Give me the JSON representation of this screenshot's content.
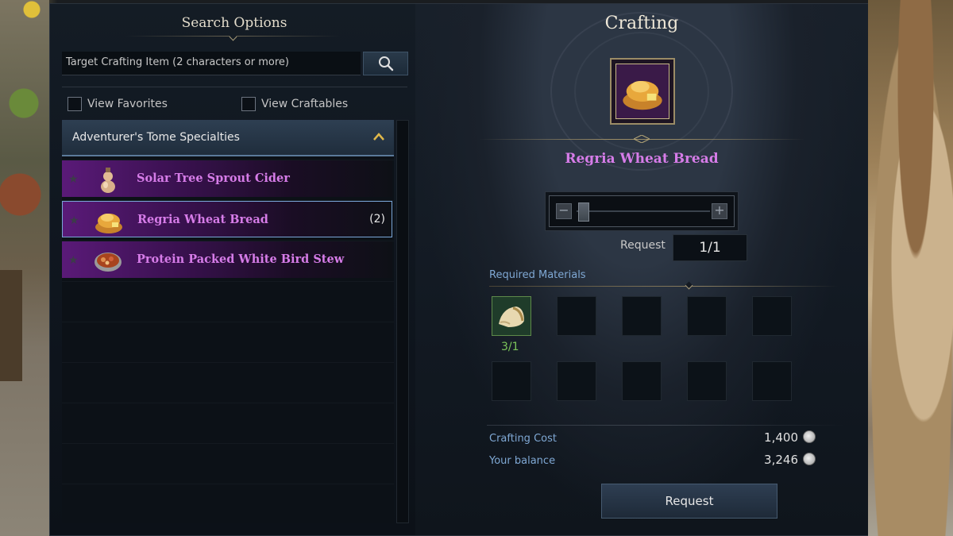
{
  "search_panel": {
    "title": "Search Options",
    "search_placeholder": "Target Crafting Item (2 characters or more)",
    "filters": [
      {
        "label": "View Favorites",
        "checked": false
      },
      {
        "label": "View Craftables",
        "checked": false
      }
    ],
    "category": {
      "label": "Adventurer's Tome Specialties",
      "expanded": true
    },
    "items": [
      {
        "name": "Solar Tree Sprout Cider",
        "count": "",
        "icon": "gourd-bottle-icon",
        "selected": false
      },
      {
        "name": "Regria Wheat Bread",
        "count": "(2)",
        "icon": "wheat-bread-icon",
        "selected": true
      },
      {
        "name": "Protein Packed White Bird Stew",
        "count": "",
        "icon": "stew-bowl-icon",
        "selected": false
      }
    ]
  },
  "crafting_panel": {
    "title": "Crafting",
    "selected_item": {
      "name": "Regria Wheat Bread",
      "icon": "wheat-bread-icon",
      "rarity_color": "#d67ce8"
    },
    "quantity_slider": {
      "value": 1,
      "max": 1
    },
    "request_label": "Request",
    "request_value": "1/1",
    "required_materials": {
      "title": "Required Materials",
      "slots": [
        {
          "icon": "flour-sack-icon",
          "qty": "3/1"
        },
        {},
        {},
        {},
        {},
        {},
        {},
        {},
        {},
        {}
      ]
    },
    "cost": {
      "crafting_cost_label": "Crafting Cost",
      "crafting_cost_value": "1,400",
      "balance_label": "Your balance",
      "balance_value": "3,246",
      "currency_icon": "silver-coin-icon"
    },
    "request_button": "Request"
  },
  "colors": {
    "epic_purple": "#d67ce8",
    "material_ok_green": "#7cc45a",
    "label_blue": "#7fa8d4"
  }
}
